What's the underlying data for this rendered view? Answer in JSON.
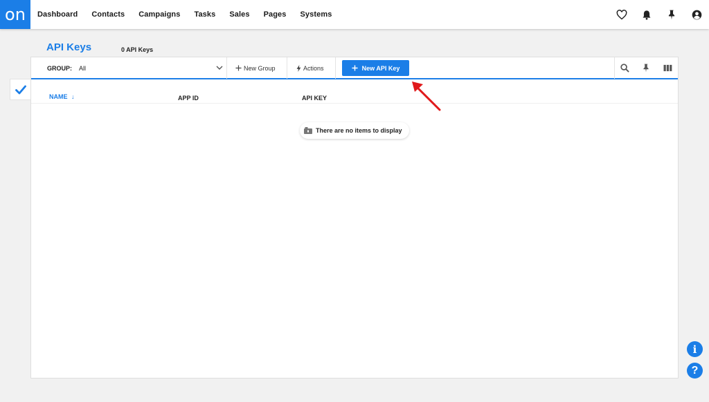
{
  "app": {
    "logo_text": "on",
    "brand_color": "#1b7ee7"
  },
  "nav": {
    "items": [
      {
        "label": "Dashboard"
      },
      {
        "label": "Contacts"
      },
      {
        "label": "Campaigns"
      },
      {
        "label": "Tasks"
      },
      {
        "label": "Sales"
      },
      {
        "label": "Pages"
      },
      {
        "label": "Systems"
      }
    ],
    "icons": [
      "heart-icon",
      "bell-icon",
      "pin-icon",
      "user-icon"
    ]
  },
  "page": {
    "title": "API Keys",
    "count_label": "0 API Keys"
  },
  "toolbar": {
    "group_label": "GROUP:",
    "group_value": "All",
    "new_group_label": "New Group",
    "actions_label": "Actions",
    "new_api_key_label": "New API Key",
    "right_icons": [
      "search-icon",
      "pin-icon",
      "columns-icon"
    ]
  },
  "table": {
    "columns": [
      {
        "label": "NAME",
        "sorted": true,
        "sort_glyph": "↓"
      },
      {
        "label": "APP ID"
      },
      {
        "label": "API KEY"
      }
    ],
    "rows": [],
    "empty_message": "There are no items to display"
  },
  "floating": {
    "info_glyph": "i",
    "help_glyph": "?"
  },
  "annotation": {
    "arrow_color": "#e0191b"
  }
}
